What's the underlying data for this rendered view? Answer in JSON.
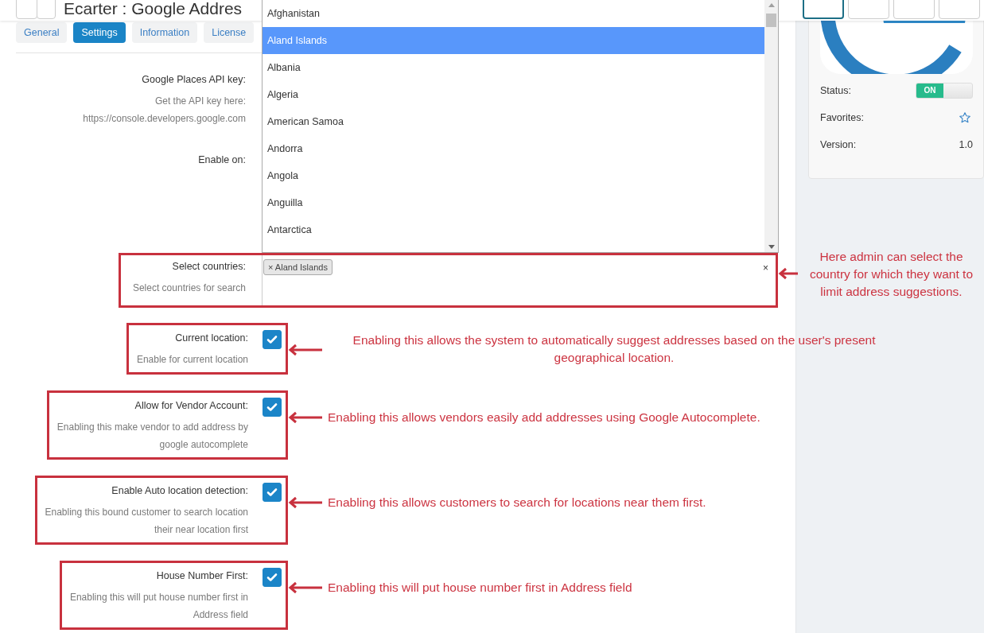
{
  "header": {
    "title": "Ecarter : Google Addres",
    "left_buttons": [
      {
        "selected": false
      },
      {
        "selected": false
      }
    ],
    "right_buttons": [
      {
        "selected": true
      },
      {
        "selected": false
      },
      {
        "selected": false
      },
      {
        "selected": false
      }
    ]
  },
  "tabs": [
    {
      "label": "General",
      "selected": false
    },
    {
      "label": "Settings",
      "selected": true
    },
    {
      "label": "Information",
      "selected": false
    },
    {
      "label": "License",
      "selected": false
    }
  ],
  "api_key": {
    "label": "Google Places API key:",
    "hint_lines": [
      "Get the API key here:",
      "https://console.developers.google.com"
    ]
  },
  "enable_on": {
    "label": "Enable on:"
  },
  "country_dropdown": {
    "items": [
      {
        "label": "Afghanistan",
        "selected": false
      },
      {
        "label": "Aland Islands",
        "selected": true
      },
      {
        "label": "Albania",
        "selected": false
      },
      {
        "label": "Algeria",
        "selected": false
      },
      {
        "label": "American Samoa",
        "selected": false
      },
      {
        "label": "Andorra",
        "selected": false
      },
      {
        "label": "Angola",
        "selected": false
      },
      {
        "label": "Anguilla",
        "selected": false
      },
      {
        "label": "Antarctica",
        "selected": false
      }
    ]
  },
  "settings": [
    {
      "kind": "select",
      "label": "Select countries:",
      "hint_lines": [
        "Select countries for search"
      ],
      "tags": [
        {
          "remove": "×",
          "label": "Aland Islands"
        }
      ],
      "clear": "×",
      "annotation": "Here admin can select the country for which they want to limit address suggestions."
    },
    {
      "kind": "checkbox",
      "label": "Current location:",
      "hint_lines": [
        "Enable for current location"
      ],
      "checked": true,
      "annotation": "Enabling this allows the system to automatically suggest addresses based on the user's present geographical location."
    },
    {
      "kind": "checkbox",
      "label": "Allow for Vendor Account:",
      "hint_lines": [
        "Enabling this make vendor to add address by",
        "google autocomplete"
      ],
      "checked": true,
      "annotation": "Enabling this allows vendors easily add addresses using Google Autocomplete."
    },
    {
      "kind": "checkbox",
      "label": "Enable Auto location detection:",
      "hint_lines": [
        "Enabling this bound customer to search location",
        "their near location first"
      ],
      "checked": true,
      "annotation": "Enabling this allows customers to search for locations near them first."
    },
    {
      "kind": "checkbox",
      "label": "House Number First:",
      "hint_lines": [
        "Enabling this will put house number first in",
        "Address field"
      ],
      "checked": true,
      "annotation": "Enabling this will put house number first in Address field"
    }
  ],
  "app_card": {
    "status": {
      "label": "Status:",
      "on": true,
      "text": "ON"
    },
    "favorites": {
      "label": "Favorites:"
    },
    "version": {
      "label": "Version:",
      "value": "1.0"
    }
  }
}
